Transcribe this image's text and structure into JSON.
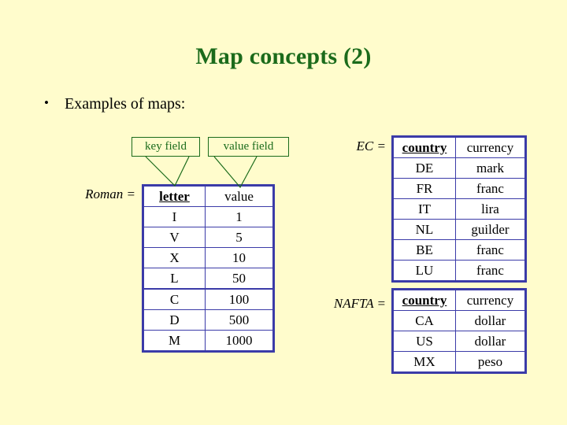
{
  "slide": {
    "title": "Map concepts (2)",
    "background_color": "#fffccc",
    "title_color": "#1b6b1b",
    "table_border_color": "#3b3ba8",
    "callout_color": "#1b6b1b",
    "bullet_glyph": "•",
    "bullet_text": "Examples of maps:"
  },
  "callouts": {
    "key_field": "key field",
    "value_field": "value field"
  },
  "labels": {
    "roman": "Roman =",
    "ec": "EC =",
    "nafta": "NAFTA ="
  },
  "tables": {
    "roman": {
      "headers": [
        "letter",
        "value"
      ],
      "rows": [
        [
          "I",
          "1"
        ],
        [
          "V",
          "5"
        ],
        [
          "X",
          "10"
        ],
        [
          "L",
          "50"
        ],
        [
          "C",
          "100"
        ],
        [
          "D",
          "500"
        ],
        [
          "M",
          "1000"
        ]
      ]
    },
    "ec": {
      "headers": [
        "country",
        "currency"
      ],
      "rows": [
        [
          "DE",
          "mark"
        ],
        [
          "FR",
          "franc"
        ],
        [
          "IT",
          "lira"
        ],
        [
          "NL",
          "guilder"
        ],
        [
          "BE",
          "franc"
        ],
        [
          "LU",
          "franc"
        ]
      ]
    },
    "nafta": {
      "headers": [
        "country",
        "currency"
      ],
      "rows": [
        [
          "CA",
          "dollar"
        ],
        [
          "US",
          "dollar"
        ],
        [
          "MX",
          "peso"
        ]
      ]
    }
  }
}
